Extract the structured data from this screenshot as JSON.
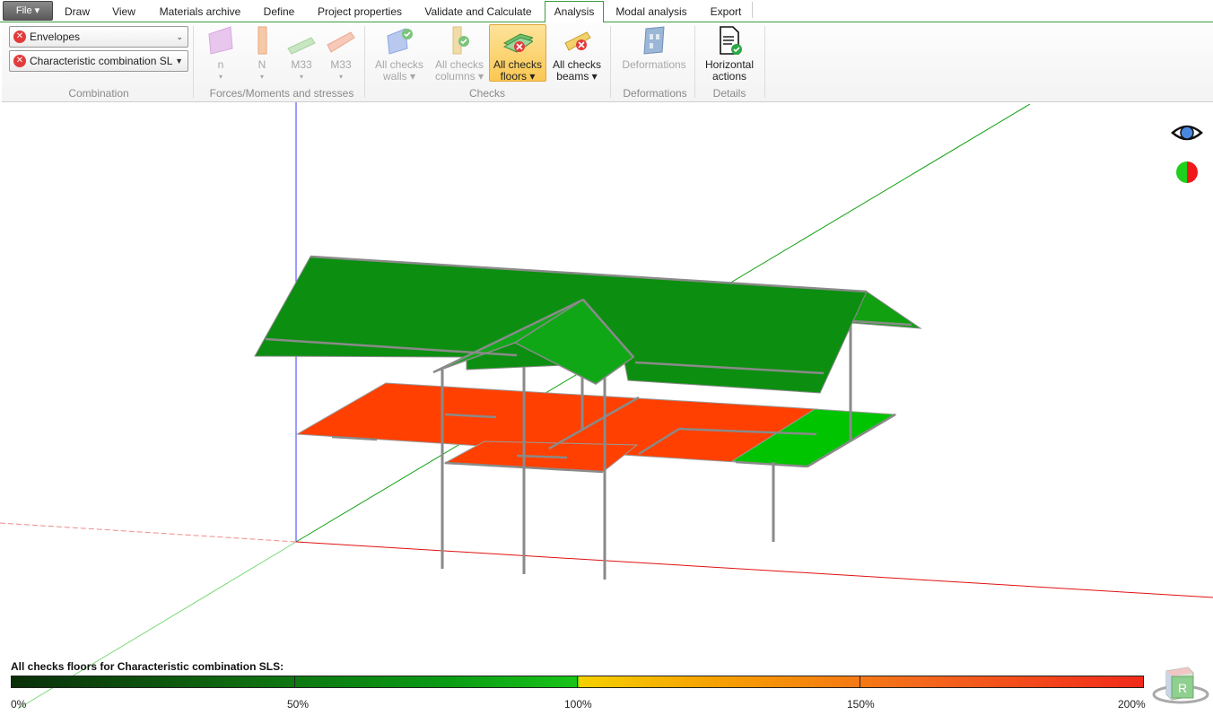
{
  "tabs": {
    "file": "File",
    "items": [
      "Draw",
      "View",
      "Materials archive",
      "Define",
      "Project properties",
      "Validate and Calculate",
      "Analysis",
      "Modal analysis",
      "Export"
    ],
    "active": "Analysis"
  },
  "ribbon": {
    "combination": {
      "envelopes": "Envelopes",
      "characteristic": "Characteristic combination SL",
      "group_label": "Combination"
    },
    "forces": {
      "buttons": [
        "n",
        "N",
        "M33",
        "M33"
      ],
      "group_label": "Forces/Moments and stresses"
    },
    "checks": {
      "walls": [
        "All checks",
        "walls"
      ],
      "columns": [
        "All checks",
        "columns"
      ],
      "floors": [
        "All checks",
        "floors"
      ],
      "beams": [
        "All checks",
        "beams"
      ],
      "group_label": "Checks"
    },
    "deformations": {
      "button": "Deformations",
      "group_label": "Deformations"
    },
    "details": {
      "button": [
        "Horizontal",
        "actions"
      ],
      "group_label": "Details"
    }
  },
  "legend": {
    "title": "All checks floors for Characteristic combination SLS:",
    "ticks": [
      "0%",
      "50%",
      "100%",
      "150%",
      "200%"
    ]
  },
  "cube_label": "R",
  "colors": {
    "roof": "#0c8f10",
    "floor_fail": "#ff4000",
    "floor_ok": "#00c000",
    "accent": "#3c9a3c"
  }
}
